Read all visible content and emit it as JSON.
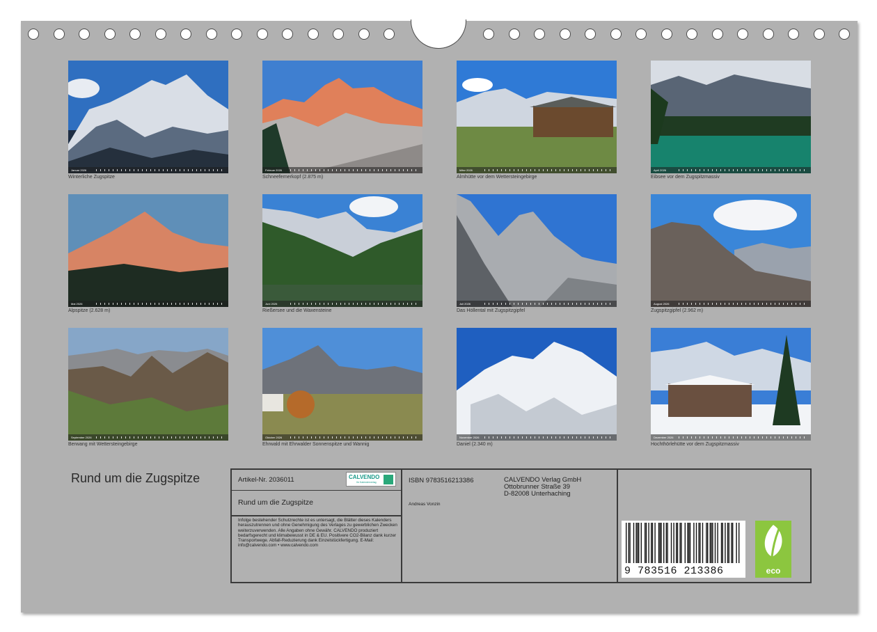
{
  "calendar": {
    "title": "Rund um die Zugspitze",
    "months": [
      {
        "caption": "Winterliche Zugspitze",
        "strip_label": "Januar 2026"
      },
      {
        "caption": "Schneefernerkopf (2.875 m)",
        "strip_label": "Februar 2026"
      },
      {
        "caption": "Almhütte vor dem Wettersteingebirge",
        "strip_label": "März 2026"
      },
      {
        "caption": "Eibsee vor dem Zugspitzmassiv",
        "strip_label": "April 2026"
      },
      {
        "caption": "Alpspitze (2.628 m)",
        "strip_label": "Mai 2026"
      },
      {
        "caption": "Rießersee und die Waxensteine",
        "strip_label": "Juni 2026"
      },
      {
        "caption": "Das Höllental mit Zugspitzgipfel",
        "strip_label": "Juli 2026"
      },
      {
        "caption": "Zugspitzgipfel (2.962 m)",
        "strip_label": "August 2026"
      },
      {
        "caption": "Berwang mit Wettersteingebirge",
        "strip_label": "September 2026"
      },
      {
        "caption": "Ehrwald mit Ehrwalder Sonnenspitze und Wannig",
        "strip_label": "Oktober 2026"
      },
      {
        "caption": "Daniel (2.340 m)",
        "strip_label": "November 2026"
      },
      {
        "caption": "Hochthörlehütte vor dem Zugspitzmassiv",
        "strip_label": "Dezember 2026"
      }
    ]
  },
  "info": {
    "article_no": "Artikel-Nr. 2036011",
    "logo_word": "CALVENDO",
    "logo_sub": "Ihr Kalenderverlag",
    "title": "Rund um die Zugspitze",
    "legal_text": "Infolge bestehender Schutzrechte ist es untersagt, die Blätter dieses Kalenders herauszutrennen und ohne Genehmigung des Verlages zu gewerblichen Zwecken weiterzuverwenden. Alle Angaben ohne Gewähr. CALVENDO produziert bedarfsgerecht und klimabewusst in DE & EU. Positivere CO2-Bilanz dank kurzer Transportwege. Abfall-Reduzierung dank Einzelstückfertigung. E-Mail: info@calvendo.com • www.calvendo.com",
    "isbn": "ISBN 9783516213386",
    "author": "Andreas Vonzin",
    "publisher": "CALVENDO Verlag GmbH",
    "street": "Ottobrunner Straße 39",
    "city": "D-82008 Unterhaching",
    "ean": "9 783516 213386",
    "eco_label": "eco"
  },
  "colors": {
    "page_background": "#b1b1b1",
    "eco_green": "#8cc63f",
    "calvendo_teal": "#1a9a8a"
  },
  "icons": [
    "calvendo-logo",
    "barcode",
    "eco-leaf-icon"
  ]
}
